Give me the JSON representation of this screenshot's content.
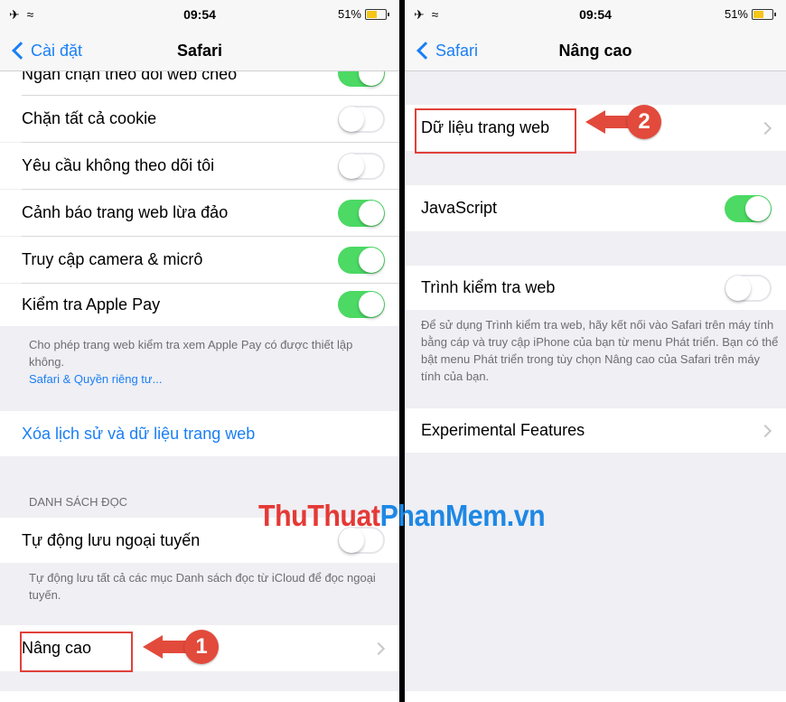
{
  "left": {
    "status": {
      "signal": "✈ ≈",
      "time": "09:54",
      "battery": "51%"
    },
    "nav": {
      "back": "Cài đặt",
      "title": "Safari"
    },
    "rows": [
      {
        "label": "Ngăn chặn theo dõi web chéo",
        "toggle": "on"
      },
      {
        "label": "Chặn tất cả cookie",
        "toggle": "off"
      },
      {
        "label": "Yêu cầu không theo dõi tôi",
        "toggle": "off"
      },
      {
        "label": "Cảnh báo trang web lừa đảo",
        "toggle": "on"
      },
      {
        "label": "Truy cập camera & micrô",
        "toggle": "on"
      },
      {
        "label": "Kiểm tra Apple Pay",
        "toggle": "on"
      }
    ],
    "applepay_footer": "Cho phép trang web kiểm tra xem Apple Pay có được thiết lập không.",
    "privacy_link": "Safari & Quyền riêng tư...",
    "clear_history": "Xóa lịch sử và dữ liệu trang web",
    "reading_list_header": "DANH SÁCH ĐỌC",
    "offline_save": {
      "label": "Tự động lưu ngoại tuyến",
      "toggle": "off"
    },
    "offline_footer": "Tự động lưu tất cả các mục Danh sách đọc từ iCloud để đọc ngoại tuyến.",
    "advanced": "Nâng cao",
    "callout_number": "1"
  },
  "right": {
    "status": {
      "signal": "✈ ≈",
      "time": "09:54",
      "battery": "51%"
    },
    "nav": {
      "back": "Safari",
      "title": "Nâng cao"
    },
    "website_data": "Dữ liệu trang web",
    "javascript": {
      "label": "JavaScript",
      "toggle": "on"
    },
    "web_inspector": {
      "label": "Trình kiểm tra web",
      "toggle": "off"
    },
    "inspector_footer": "Để sử dụng Trình kiểm tra web, hãy kết nối vào Safari trên máy tính bằng cáp và truy cập iPhone của bạn từ menu Phát triển. Bạn có thể bật menu Phát triển trong tùy chọn Nâng cao của Safari trên máy tính của bạn.",
    "experimental": "Experimental Features",
    "callout_number": "2"
  },
  "watermark": {
    "part1": "ThuThuat",
    "part2": "PhanMem.vn"
  },
  "colors": {
    "accent": "#1a7ff5",
    "toggle_on": "#4cd964",
    "callout": "#e24a3b",
    "highlight_box": "#e0413a"
  }
}
